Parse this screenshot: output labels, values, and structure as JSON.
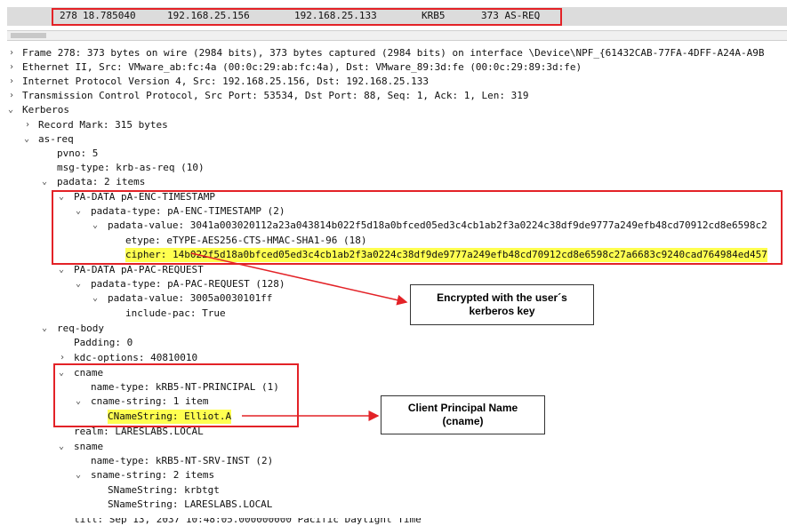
{
  "packet": {
    "no": "278",
    "time": "18.785040",
    "src": "192.168.25.156",
    "dst": "192.168.25.133",
    "proto": "KRB5",
    "info": "373 AS-REQ"
  },
  "tree": {
    "frame": "Frame 278: 373 bytes on wire (2984 bits), 373 bytes captured (2984 bits) on interface \\Device\\NPF_{61432CAB-77FA-4DFF-A24A-A9B",
    "ethernet": "Ethernet II, Src: VMware_ab:fc:4a (00:0c:29:ab:fc:4a), Dst: VMware_89:3d:fe (00:0c:29:89:3d:fe)",
    "ip": "Internet Protocol Version 4, Src: 192.168.25.156, Dst: 192.168.25.133",
    "tcp": "Transmission Control Protocol, Src Port: 53534, Dst Port: 88, Seq: 1, Ack: 1, Len: 319",
    "kerberos": "Kerberos",
    "record_mark": "Record Mark: 315 bytes",
    "as_req": "as-req",
    "pvno": "pvno: 5",
    "msg_type": "msg-type: krb-as-req (10)",
    "padata": "padata: 2 items",
    "pa_enc": "PA-DATA pA-ENC-TIMESTAMP",
    "padata_type_1": "padata-type: pA-ENC-TIMESTAMP (2)",
    "padata_value_1": "padata-value: 3041a003020112a23a043814b022f5d18a0bfced05ed3c4cb1ab2f3a0224c38df9de9777a249efb48cd70912cd8e6598c2",
    "etype": "etype: eTYPE-AES256-CTS-HMAC-SHA1-96 (18)",
    "cipher": "cipher: 14b022f5d18a0bfced05ed3c4cb1ab2f3a0224c38df9de9777a249efb48cd70912cd8e6598c27a6683c9240cad764984ed457",
    "pa_pac": "PA-DATA pA-PAC-REQUEST",
    "padata_type_2": "padata-type: pA-PAC-REQUEST (128)",
    "padata_value_2": "padata-value: 3005a0030101ff",
    "include_pac": "include-pac: True",
    "req_body": "req-body",
    "padding": "Padding: 0",
    "kdc_options": "kdc-options: 40810010",
    "cname": "cname",
    "name_type_1": "name-type: kRB5-NT-PRINCIPAL (1)",
    "cname_string": "cname-string: 1 item",
    "cname_value": "CNameString: Elliot.A",
    "realm": "realm: LARESLABS.LOCAL",
    "sname": "sname",
    "name_type_2": "name-type: kRB5-NT-SRV-INST (2)",
    "sname_string": "sname-string: 2 items",
    "sname_value_1": "SNameString: krbtgt",
    "sname_value_2": "SNameString: LARESLABS.LOCAL",
    "till": "till: Sep 13, 2037 10:48:05.000000000 Pacific Daylight Time"
  },
  "callouts": {
    "encrypted_line1": "Encrypted with the user´s",
    "encrypted_line2": "kerberos key",
    "client_line1": "Client Principal Name",
    "client_line2": "(cname)"
  },
  "colors": {
    "annotation_red": "#e32227",
    "highlight_yellow": "#ffff50",
    "selected_row": "#dcdcdc"
  },
  "icons": {
    "expanded": "chevron-down-icon",
    "collapsed": "chevron-right-icon"
  }
}
